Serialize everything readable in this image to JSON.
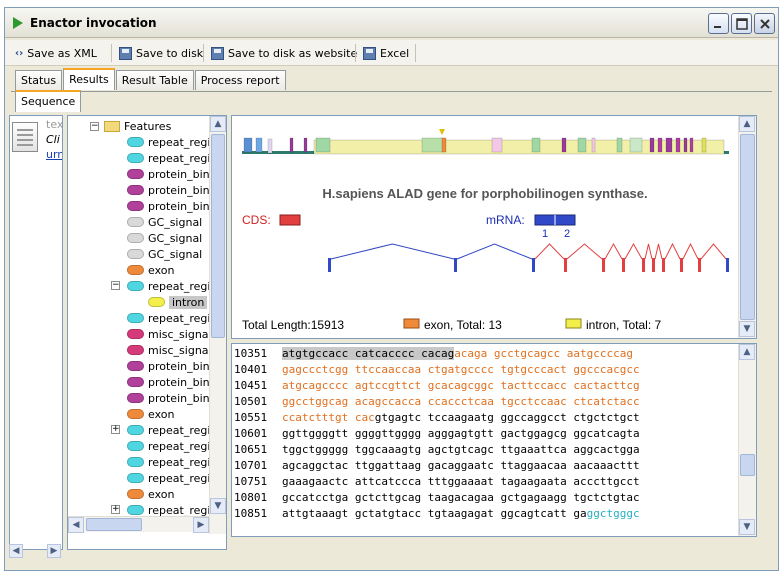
{
  "window": {
    "title": "Enactor invocation"
  },
  "toolbar": {
    "save_xml": "Save as XML",
    "save_disk": "Save to disk",
    "save_website": "Save to disk as website",
    "excel": "Excel"
  },
  "main_tabs": [
    "Status",
    "Results",
    "Result Table",
    "Process report"
  ],
  "sub_tabs": [
    "Sequence"
  ],
  "left_strip": {
    "texts": [
      "tex",
      "Cli",
      "urn"
    ]
  },
  "tree": {
    "root": "Features",
    "items": [
      {
        "label": "repeat_regi",
        "type": "repeat"
      },
      {
        "label": "repeat_regi",
        "type": "repeat"
      },
      {
        "label": "protein_binc",
        "type": "protein"
      },
      {
        "label": "protein_binc",
        "type": "protein"
      },
      {
        "label": "protein_binc",
        "type": "protein"
      },
      {
        "label": "GC_signal",
        "type": "gc"
      },
      {
        "label": "GC_signal",
        "type": "gc"
      },
      {
        "label": "GC_signal",
        "type": "gc"
      },
      {
        "label": "exon",
        "type": "exon"
      },
      {
        "label": "repeat_regi",
        "type": "repeat",
        "expanded": true
      },
      {
        "label": "intron",
        "type": "intron",
        "child": true,
        "selected": true
      },
      {
        "label": "repeat_regi",
        "type": "repeat"
      },
      {
        "label": "misc_signal",
        "type": "misc"
      },
      {
        "label": "misc_signal",
        "type": "misc"
      },
      {
        "label": "protein_binc",
        "type": "protein"
      },
      {
        "label": "protein_binc",
        "type": "protein"
      },
      {
        "label": "protein_binc",
        "type": "protein"
      },
      {
        "label": "exon",
        "type": "exon"
      },
      {
        "label": "repeat_regi",
        "type": "repeat",
        "collapsed": true
      },
      {
        "label": "repeat_regi",
        "type": "repeat"
      },
      {
        "label": "repeat_regi",
        "type": "repeat"
      },
      {
        "label": "repeat_regi",
        "type": "repeat"
      },
      {
        "label": "exon",
        "type": "exon"
      },
      {
        "label": "repeat_regi",
        "type": "repeat",
        "collapsed": true
      }
    ]
  },
  "gene_view": {
    "title": "H.sapiens ALAD gene for porphobilinogen synthase.",
    "cds_label": "CDS:",
    "mrna_label": "mRNA:",
    "mrna_numbers": [
      "1",
      "2"
    ],
    "total_length": "Total Length:15913",
    "exon_total": "exon, Total: 13",
    "intron_total": "intron, Total: 7"
  },
  "sequence": [
    {
      "num": "10351",
      "segments": [
        {
          "t": "atgtgccacc catcacccc cacag",
          "s": "hl"
        },
        {
          "t": "acaga gcctgcagcc aatgccccag",
          "s": "o"
        }
      ]
    },
    {
      "num": "10401",
      "segments": [
        {
          "t": "gagccctcgg ttccaaccaa ctgatgcccc tgtgcccact ggcccacgcc",
          "s": "o"
        }
      ]
    },
    {
      "num": "10451",
      "segments": [
        {
          "t": "atgcagcccc agtccgttct gcacagcggc tacttccacc cactacttcg",
          "s": "o"
        }
      ]
    },
    {
      "num": "10501",
      "segments": [
        {
          "t": "ggcctggcag acagccacca ccaccctcaa tgcctccaac ctcatctacc",
          "s": "o"
        }
      ]
    },
    {
      "num": "10551",
      "segments": [
        {
          "t": "ccatctttgt cac",
          "s": "o"
        },
        {
          "t": "gtgagtc tccaagaatg ggccaggcct ctgctctgct",
          "s": ""
        }
      ]
    },
    {
      "num": "10601",
      "segments": [
        {
          "t": "ggttggggtt ggggttgggg agggagtgtt gactggagcg ggcatcagta",
          "s": ""
        }
      ]
    },
    {
      "num": "10651",
      "segments": [
        {
          "t": "tggctggggg tggcaaagtg agctgtcagc ttgaaattca aggcactgga",
          "s": ""
        }
      ]
    },
    {
      "num": "10701",
      "segments": [
        {
          "t": "agcaggctac ttggattaag gacaggaatc ttaggaacaa aacaaacttt",
          "s": ""
        }
      ]
    },
    {
      "num": "10751",
      "segments": [
        {
          "t": "gaaagaactc attcatccca tttggaaaat tagaagaata acccttgcct",
          "s": ""
        }
      ]
    },
    {
      "num": "10801",
      "segments": [
        {
          "t": "gccatcctga gctcttgcag taagacagaa gctgagaagg tgctctgtac",
          "s": ""
        }
      ]
    },
    {
      "num": "10851",
      "segments": [
        {
          "t": "attgtaaagt gctatgtacc tgtaagagat ggcagtcatt ga",
          "s": ""
        },
        {
          "t": "ggctgggc",
          "s": "c"
        }
      ]
    }
  ],
  "colors": {
    "repeat": "#4fd6e0",
    "protein": "#b0409a",
    "gc": "#d9d9d9",
    "exon": "#ef8a3b",
    "intron": "#f2ee4a",
    "misc": "#d63a7a",
    "cds": "#e24040",
    "mrna": "#3148c8"
  }
}
